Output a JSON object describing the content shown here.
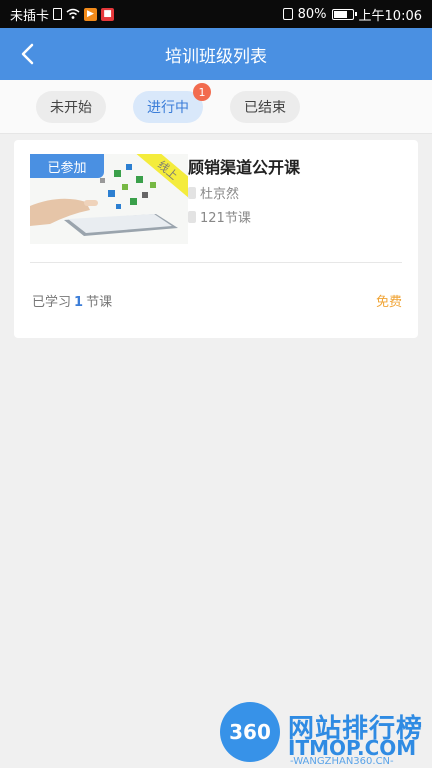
{
  "status_bar": {
    "carrier": "未插卡",
    "battery_text": "80%",
    "time": "上午10:06"
  },
  "header": {
    "title": "培训班级列表",
    "back_icon": "chevron-left-icon"
  },
  "tabs": [
    {
      "label": "未开始",
      "active": false
    },
    {
      "label": "进行中",
      "active": true,
      "badge": "1"
    },
    {
      "label": "已结束",
      "active": false
    }
  ],
  "course": {
    "joined_tag": "已参加",
    "ribbon": "线上",
    "title": "顾销渠道公开课",
    "teacher": "杜京然",
    "lessons": "121节课",
    "progress_prefix": "已学习",
    "progress_count": "1",
    "progress_suffix": "节课",
    "price": "免费"
  },
  "watermark": {
    "logo": "360",
    "title": "网站排行榜",
    "domain": "ITMOP.COM",
    "sub": "-WANGZHAN360.CN-"
  },
  "colors": {
    "header_bg": "#4a90e2",
    "accent": "#3b7dd8",
    "badge": "#f26b4e",
    "price": "#f0a436"
  }
}
